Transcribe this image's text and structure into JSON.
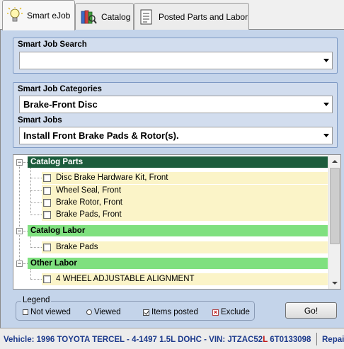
{
  "tabs": [
    {
      "label": "Smart eJob",
      "icon": "lightbulb-icon",
      "active": true
    },
    {
      "label": "Catalog",
      "icon": "catalog-books-icon",
      "active": false
    },
    {
      "label": "Posted Parts and Labor",
      "icon": "document-list-icon",
      "active": false
    }
  ],
  "search": {
    "title": "Smart Job Search",
    "value": ""
  },
  "categories": {
    "title": "Smart Job Categories",
    "value": "Brake-Front Disc"
  },
  "jobs": {
    "title": "Smart Jobs",
    "value": "Install Front Brake Pads & Rotor(s)."
  },
  "tree": {
    "groups": [
      {
        "title": "Catalog Parts",
        "items": [
          "Disc Brake Hardware Kit, Front",
          "Wheel Seal, Front",
          "Brake Rotor, Front",
          "Brake Pads, Front"
        ]
      },
      {
        "title": "Catalog Labor",
        "items": [
          "Brake Pads"
        ]
      },
      {
        "title": "Other Labor",
        "items": [
          "4 WHEEL ADJUSTABLE ALIGNMENT"
        ]
      }
    ],
    "expander_symbol": "−"
  },
  "legend": {
    "title": "Legend",
    "not_viewed": "Not viewed",
    "viewed": "Viewed",
    "items_posted": "Items posted",
    "exclude": "Exclude",
    "exclude_mark": "×"
  },
  "go_button": "Go!",
  "status": {
    "vehicle_prefix": "Vehicle: 1996 TOYOTA TERCEL - 4-1497 1.5L DOHC - VIN: JTZAC52",
    "vehicle_red": "L",
    "vehicle_suffix": " 6T0133098",
    "repair": "Repai"
  },
  "colors": {
    "panel_bg": "#c4d4ea",
    "header_dark": "#1c5c3c",
    "header_light": "#7fe07f",
    "item_bg": "#fbf4c8",
    "status_text": "#1c3a8c",
    "status_red": "#c01818"
  }
}
